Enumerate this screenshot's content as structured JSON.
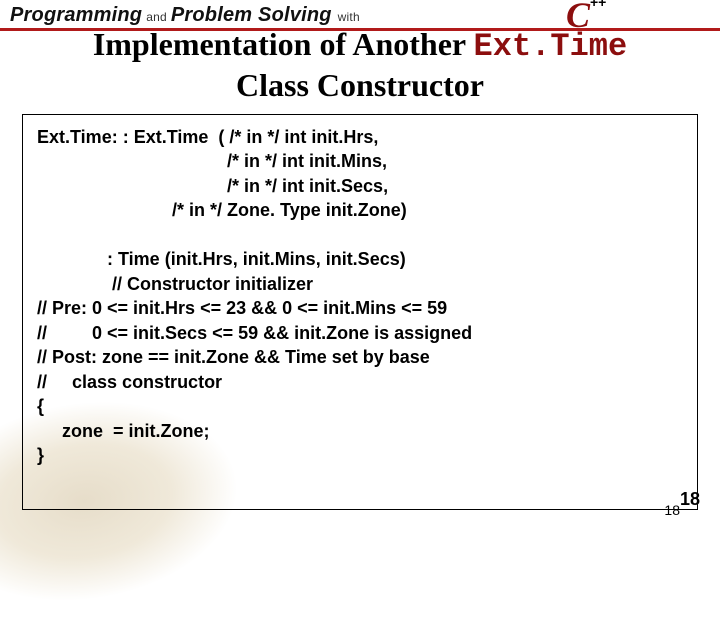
{
  "banner": {
    "prog": "Programming",
    "and": "and",
    "problem": "Problem Solving",
    "with": "with",
    "logo_c": "C",
    "logo_pp": "++"
  },
  "title": {
    "prefix": "Implementation of Another ",
    "mono": "Ext.Time",
    "line2": "Class Constructor"
  },
  "code": {
    "l1": "Ext.Time: : Ext.Time  ( /* in */ int init.Hrs,",
    "l2": "                                      /* in */ int init.Mins,",
    "l3": "                                      /* in */ int init.Secs,",
    "l4": "                           /* in */ Zone. Type init.Zone)",
    "l5": "",
    "l6": "              : Time (init.Hrs, init.Mins, init.Secs)",
    "l7": "               // Constructor initializer",
    "l8": "// Pre: 0 <= init.Hrs <= 23 && 0 <= init.Mins <= 59",
    "l9": "//         0 <= init.Secs <= 59 && init.Zone is assigned",
    "l10": "// Post: zone == init.Zone && Time set by base",
    "l11": "//     class constructor",
    "l12": "{",
    "l13": "     zone  = init.Zone;",
    "l14": "}"
  },
  "page": {
    "small": "18",
    "big": "18"
  }
}
